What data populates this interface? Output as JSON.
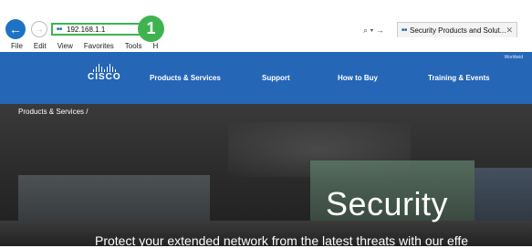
{
  "browser": {
    "address": "192.168.1.1",
    "callout_number": "1",
    "search_control": "⌕ ▾ →",
    "tab_title": "Security Products and Solut...",
    "tab_close": "✕",
    "menu": [
      "File",
      "Edit",
      "View",
      "Favorites",
      "Tools",
      "H"
    ]
  },
  "site": {
    "logo_text": "CISCO",
    "worldwide": "Worldwid",
    "nav": [
      "Products & Services",
      "Support",
      "How to Buy",
      "Training & Events"
    ],
    "breadcrumb": "Products & Services  /",
    "hero_title": "Security",
    "hero_subtitle": "Protect your extended network from the latest threats with our effe"
  },
  "colors": {
    "accent_green": "#3fb34f",
    "cisco_blue": "#2566b6"
  }
}
